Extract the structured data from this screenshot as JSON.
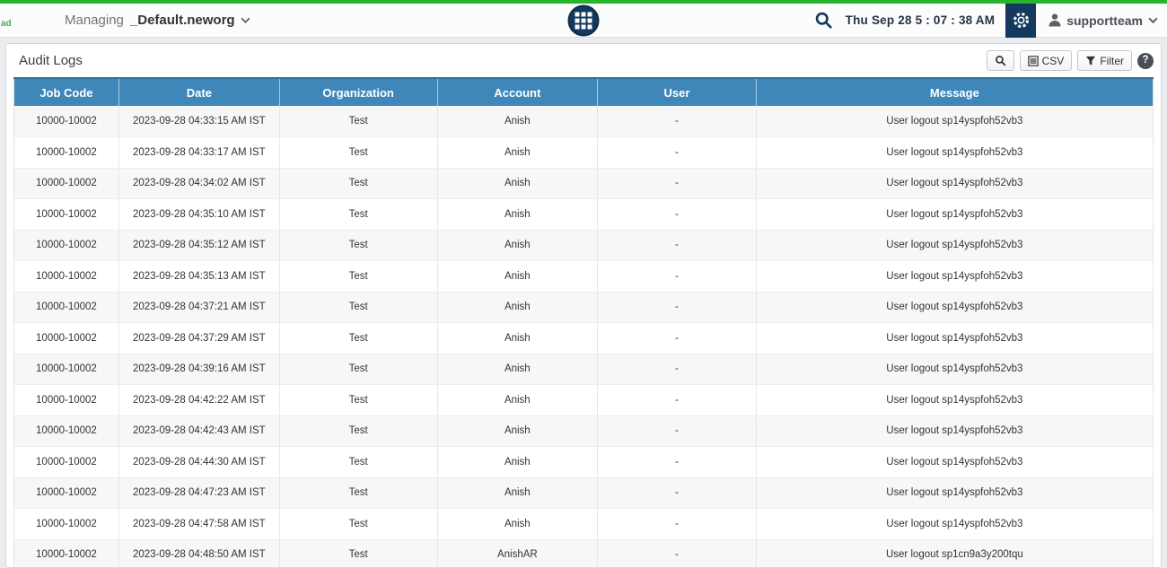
{
  "topbar": {
    "logo_text": "ad",
    "managing_label": "Managing",
    "org_name": "_Default.neworg",
    "datetime": "Thu Sep 28  5 : 07 : 38 AM",
    "username": "supportteam",
    "icons": {
      "apps": "grid-icon",
      "search": "magnifier-icon",
      "settings": "gear-icon",
      "user": "person-icon",
      "dropdowns": "chevron-down-icon"
    }
  },
  "panel": {
    "title": "Audit Logs",
    "toolbar": {
      "search": "magnifier-icon",
      "csv_label": "CSV",
      "filter_label": "Filter",
      "help_label": "?"
    }
  },
  "table": {
    "headers": [
      "Job Code",
      "Date",
      "Organization",
      "Account",
      "User",
      "Message"
    ],
    "rows": [
      {
        "job_code": "10000-10002",
        "date": "2023-09-28 04:33:15 AM IST",
        "organization": "Test",
        "account": "Anish",
        "user": "-",
        "message": "User logout sp14yspfoh52vb3"
      },
      {
        "job_code": "10000-10002",
        "date": "2023-09-28 04:33:17 AM IST",
        "organization": "Test",
        "account": "Anish",
        "user": "-",
        "message": "User logout sp14yspfoh52vb3"
      },
      {
        "job_code": "10000-10002",
        "date": "2023-09-28 04:34:02 AM IST",
        "organization": "Test",
        "account": "Anish",
        "user": "-",
        "message": "User logout sp14yspfoh52vb3"
      },
      {
        "job_code": "10000-10002",
        "date": "2023-09-28 04:35:10 AM IST",
        "organization": "Test",
        "account": "Anish",
        "user": "-",
        "message": "User logout sp14yspfoh52vb3"
      },
      {
        "job_code": "10000-10002",
        "date": "2023-09-28 04:35:12 AM IST",
        "organization": "Test",
        "account": "Anish",
        "user": "-",
        "message": "User logout sp14yspfoh52vb3"
      },
      {
        "job_code": "10000-10002",
        "date": "2023-09-28 04:35:13 AM IST",
        "organization": "Test",
        "account": "Anish",
        "user": "-",
        "message": "User logout sp14yspfoh52vb3"
      },
      {
        "job_code": "10000-10002",
        "date": "2023-09-28 04:37:21 AM IST",
        "organization": "Test",
        "account": "Anish",
        "user": "-",
        "message": "User logout sp14yspfoh52vb3"
      },
      {
        "job_code": "10000-10002",
        "date": "2023-09-28 04:37:29 AM IST",
        "organization": "Test",
        "account": "Anish",
        "user": "-",
        "message": "User logout sp14yspfoh52vb3"
      },
      {
        "job_code": "10000-10002",
        "date": "2023-09-28 04:39:16 AM IST",
        "organization": "Test",
        "account": "Anish",
        "user": "-",
        "message": "User logout sp14yspfoh52vb3"
      },
      {
        "job_code": "10000-10002",
        "date": "2023-09-28 04:42:22 AM IST",
        "organization": "Test",
        "account": "Anish",
        "user": "-",
        "message": "User logout sp14yspfoh52vb3"
      },
      {
        "job_code": "10000-10002",
        "date": "2023-09-28 04:42:43 AM IST",
        "organization": "Test",
        "account": "Anish",
        "user": "-",
        "message": "User logout sp14yspfoh52vb3"
      },
      {
        "job_code": "10000-10002",
        "date": "2023-09-28 04:44:30 AM IST",
        "organization": "Test",
        "account": "Anish",
        "user": "-",
        "message": "User logout sp14yspfoh52vb3"
      },
      {
        "job_code": "10000-10002",
        "date": "2023-09-28 04:47:23 AM IST",
        "organization": "Test",
        "account": "Anish",
        "user": "-",
        "message": "User logout sp14yspfoh52vb3"
      },
      {
        "job_code": "10000-10002",
        "date": "2023-09-28 04:47:58 AM IST",
        "organization": "Test",
        "account": "Anish",
        "user": "-",
        "message": "User logout sp14yspfoh52vb3"
      },
      {
        "job_code": "10000-10002",
        "date": "2023-09-28 04:48:50 AM IST",
        "organization": "Test",
        "account": "AnishAR",
        "user": "-",
        "message": "User logout sp1cn9a3y200tqu"
      }
    ]
  },
  "colors": {
    "accent_green": "#28b42d",
    "navy": "#15395e",
    "header_blue": "#3e87b8",
    "row_alt": "#f7f7f7"
  }
}
